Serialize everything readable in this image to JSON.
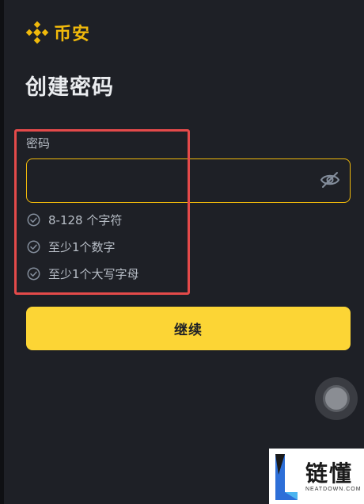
{
  "header": {
    "logo_text": "币安",
    "logo_icon": "binance-diamond-icon",
    "brand_color": "#f0b90b"
  },
  "page": {
    "title": "创建密码"
  },
  "password_field": {
    "label": "密码",
    "value": "",
    "toggle_icon": "eye-slash-icon"
  },
  "requirements": [
    {
      "text": "8-128 个字符",
      "icon": "check-circle-icon"
    },
    {
      "text": "至少1个数字",
      "icon": "check-circle-icon"
    },
    {
      "text": "至少1个大写字母",
      "icon": "check-circle-icon"
    }
  ],
  "continue_button": {
    "label": "继续",
    "color": "#fcd535"
  },
  "highlight_color": "#e44a4a",
  "watermark": {
    "title": "链懂",
    "subtitle": "NEATDOWN.COM"
  }
}
